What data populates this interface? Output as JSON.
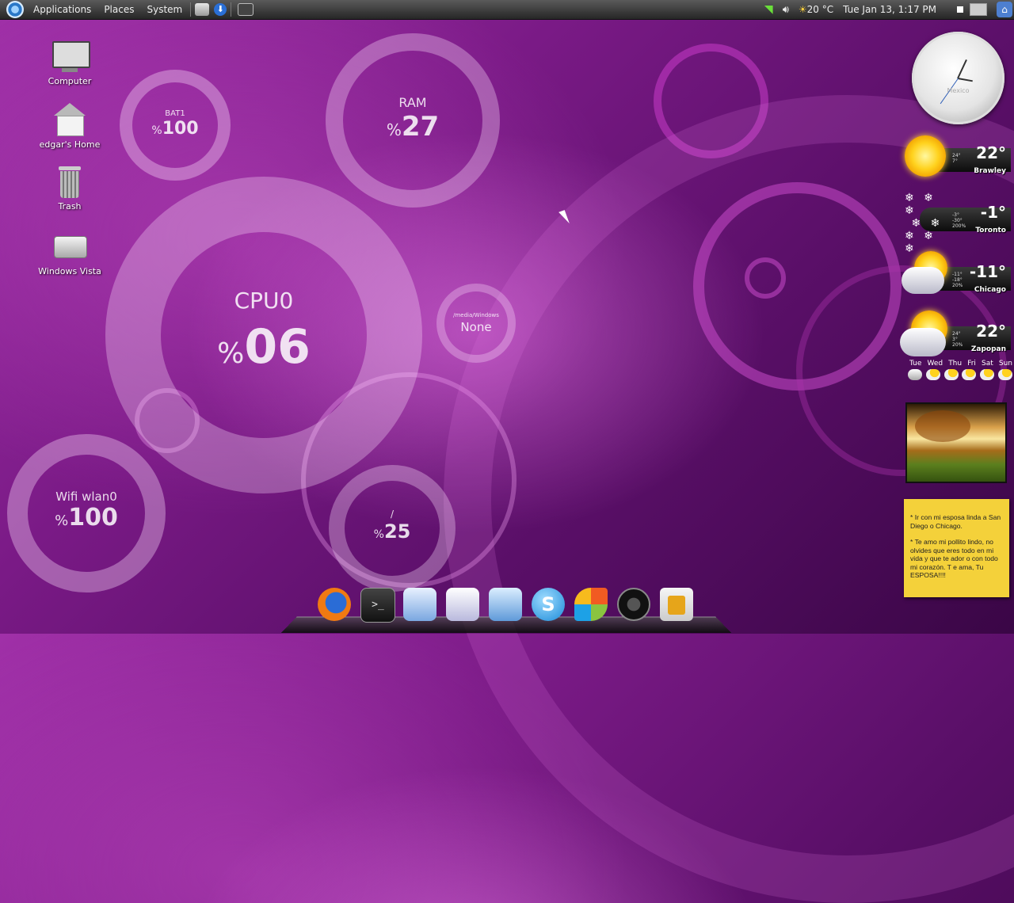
{
  "panel": {
    "menus": [
      "Applications",
      "Places",
      "System"
    ],
    "temperature": "20 °C",
    "datetime": "Tue Jan 13,  1:17 PM"
  },
  "desktop_icons": [
    {
      "label": "Computer"
    },
    {
      "label": "edgar's Home"
    },
    {
      "label": "Trash"
    },
    {
      "label": "Windows Vista"
    }
  ],
  "gauges": {
    "bat": {
      "label": "BAT1",
      "pct_sign": "%",
      "value": "100"
    },
    "ram": {
      "label": "RAM",
      "pct_sign": "%",
      "value": "27"
    },
    "cpu": {
      "label": "CPU0",
      "pct_sign": "%",
      "value": "06"
    },
    "media": {
      "label": "/media/Windows",
      "value": "None"
    },
    "wifi": {
      "label": "Wifi wlan0",
      "pct_sign": "%",
      "value": "100"
    },
    "root": {
      "label": "/",
      "pct_sign": "%",
      "value": "25"
    }
  },
  "clock": {
    "label": "Mexico"
  },
  "weather": [
    {
      "city": "Brawley",
      "temp": "22°",
      "details": [
        "24°",
        "7°"
      ]
    },
    {
      "city": "Toronto",
      "temp": "-1°",
      "details": [
        "-3°",
        "-30°",
        "200%"
      ]
    },
    {
      "city": "Chicago",
      "temp": "-11°",
      "details": [
        "-11°",
        "-18°",
        "20%"
      ]
    },
    {
      "city": "Zapopan",
      "temp": "22°",
      "details": [
        "24°",
        "3°",
        "20%"
      ]
    }
  ],
  "forecast_days": [
    "Tue",
    "Wed",
    "Thu",
    "Fri",
    "Sat",
    "Sun"
  ],
  "note": {
    "line1": "* Ir con mi esposa linda a San Diego o Chicago.",
    "line2": "* Te amo mi pollito lindo, no olvides que eres todo en mi vida y que te ador o con todo mi corazón. T e ama, Tu ESPOSA!!!!"
  }
}
